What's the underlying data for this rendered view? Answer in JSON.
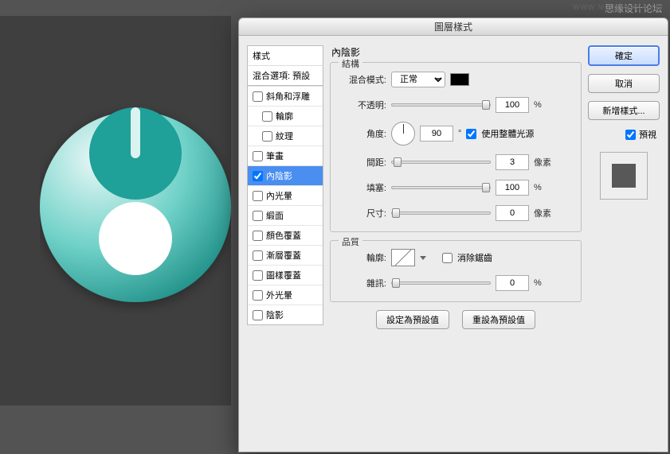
{
  "watermark": "WWW.MISSYUAN.COM",
  "top_info": "思缘设计论坛",
  "dialog": {
    "title": "圖層樣式",
    "styles_header": "樣式",
    "blend_options": "混合選項: 預設",
    "effects": [
      {
        "label": "斜角和浮雕",
        "on": false
      },
      {
        "label": "輪廓",
        "on": false
      },
      {
        "label": "紋理",
        "on": false
      },
      {
        "label": "筆畫",
        "on": false
      },
      {
        "label": "內陰影",
        "on": true,
        "selected": true
      },
      {
        "label": "內光暈",
        "on": false
      },
      {
        "label": "緞面",
        "on": false
      },
      {
        "label": "顏色覆蓋",
        "on": false
      },
      {
        "label": "漸層覆蓋",
        "on": false
      },
      {
        "label": "圖樣覆蓋",
        "on": false
      },
      {
        "label": "外光暈",
        "on": false
      },
      {
        "label": "陰影",
        "on": false
      }
    ],
    "panel_title": "內陰影",
    "group_structure": "結構",
    "group_quality": "品質",
    "labels": {
      "blend_mode": "混合模式:",
      "opacity": "不透明:",
      "angle": "角度:",
      "use_global": "使用整體光源",
      "distance": "間距:",
      "choke": "填塞:",
      "size": "尺寸:",
      "contour": "輪廓:",
      "antialias": "消除鋸齒",
      "noise": "雜訊:"
    },
    "values": {
      "blend_mode": "正常",
      "opacity": "100",
      "angle": "90",
      "distance": "3",
      "choke": "100",
      "size": "0",
      "noise": "0"
    },
    "units": {
      "pct": "%",
      "deg": "°",
      "px": "像素"
    },
    "buttons": {
      "make_default": "設定為預設值",
      "reset_default": "重設為預設值"
    }
  },
  "actions": {
    "ok": "確定",
    "cancel": "取消",
    "new_style": "新增樣式...",
    "preview": "預視"
  }
}
